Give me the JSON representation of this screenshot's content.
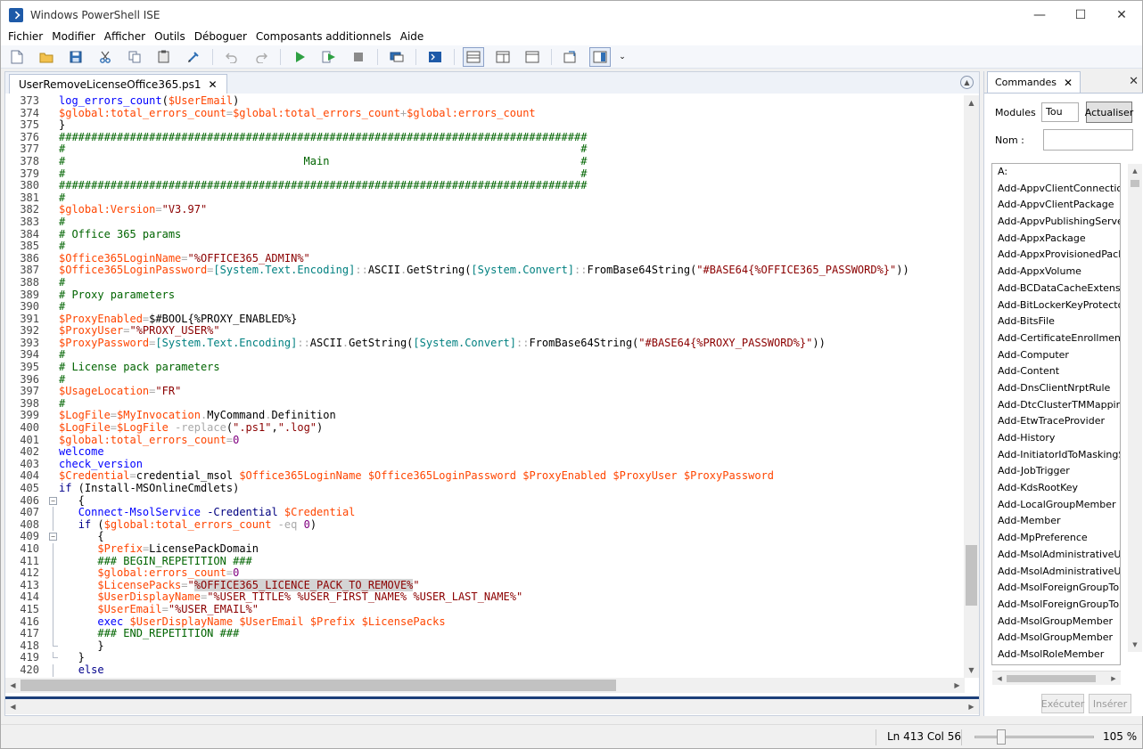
{
  "window": {
    "title": "Windows PowerShell ISE",
    "minimize": "—",
    "maximize": "☐",
    "close": "✕"
  },
  "menu": [
    "Fichier",
    "Modifier",
    "Afficher",
    "Outils",
    "Déboguer",
    "Composants additionnels",
    "Aide"
  ],
  "editor": {
    "tab_label": "UserRemoveLicenseOffice365.ps1",
    "tab_close": "✕",
    "line_numbers": [
      373,
      374,
      375,
      376,
      377,
      378,
      379,
      380,
      381,
      382,
      383,
      384,
      385,
      386,
      387,
      388,
      389,
      390,
      391,
      392,
      393,
      394,
      395,
      396,
      397,
      398,
      399,
      400,
      401,
      402,
      403,
      404,
      405,
      406,
      407,
      408,
      409,
      410,
      411,
      412,
      413,
      414,
      415,
      416,
      417,
      418,
      419,
      420
    ],
    "lines": [
      "log_errors_count($UserEmail)",
      "$global:total_errors_count=$global:total_errors_count+$global:errors_count",
      "}",
      "##################################################################################",
      "#                                                                                #",
      "#                                     Main                                       #",
      "#                                                                                #",
      "##################################################################################",
      "#",
      "$global:Version=\"V3.97\"",
      "#",
      "# Office 365 params",
      "#",
      "$Office365LoginName=\"%OFFICE365_ADMIN%\"",
      "$Office365LoginPassword=[System.Text.Encoding]::ASCII.GetString([System.Convert]::FromBase64String(\"#BASE64{%OFFICE365_PASSWORD%}\"))",
      "#",
      "# Proxy parameters",
      "#",
      "$ProxyEnabled=$#BOOL{%PROXY_ENABLED%}",
      "$ProxyUser=\"%PROXY_USER%\"",
      "$ProxyPassword=[System.Text.Encoding]::ASCII.GetString([System.Convert]::FromBase64String(\"#BASE64{%PROXY_PASSWORD%}\"))",
      "#",
      "# License pack parameters",
      "#",
      "$UsageLocation=\"FR\"",
      "#",
      "$LogFile=$MyInvocation.MyCommand.Definition",
      "$LogFile=$LogFile -replace(\".ps1\",\".log\")",
      "$global:total_errors_count=0",
      "welcome",
      "check_version",
      "$Credential=credential_msol $Office365LoginName $Office365LoginPassword $ProxyEnabled $ProxyUser $ProxyPassword",
      "if (Install-MSOnlineCmdlets)",
      "   {",
      "   Connect-MsolService -Credential $Credential",
      "   if ($global:total_errors_count -eq 0)",
      "      {",
      "      $Prefix=LicensePackDomain",
      "      ### BEGIN_REPETITION ###",
      "      $global:errors_count=0",
      "      $LicensePacks=\"%OFFICE365_LICENCE_PACK_TO_REMOVE%\"",
      "      $UserDisplayName=\"%USER_TITLE% %USER_FIRST_NAME% %USER_LAST_NAME%\"",
      "      $UserEmail=\"%USER_EMAIL%\"",
      "      exec $UserDisplayName $UserEmail $Prefix $LicensePacks",
      "      ### END_REPETITION ###",
      "      }",
      "   }",
      "   else"
    ]
  },
  "commands": {
    "tab_label": "Commandes",
    "tab_close": "✕",
    "panel_close": "✕",
    "modules_label": "Modules",
    "modules_value": "Tou",
    "refresh_label": "Actualiser",
    "name_label": "Nom :",
    "name_value": "",
    "items": [
      "A:",
      "Add-AppvClientConnection",
      "Add-AppvClientPackage",
      "Add-AppvPublishingServer",
      "Add-AppxPackage",
      "Add-AppxProvisionedPackage",
      "Add-AppxVolume",
      "Add-BCDataCacheExtension",
      "Add-BitLockerKeyProtector",
      "Add-BitsFile",
      "Add-CertificateEnrollmentPolicyServer",
      "Add-Computer",
      "Add-Content",
      "Add-DnsClientNrptRule",
      "Add-DtcClusterTMMapping",
      "Add-EtwTraceProvider",
      "Add-History",
      "Add-InitiatorIdToMaskingSet",
      "Add-JobTrigger",
      "Add-KdsRootKey",
      "Add-LocalGroupMember",
      "Add-Member",
      "Add-MpPreference",
      "Add-MsolAdministrativeUnitMember",
      "Add-MsolAdministrativeUnitMember",
      "Add-MsolForeignGroupToRole",
      "Add-MsolForeignGroupToRole",
      "Add-MsolGroupMember",
      "Add-MsolGroupMember",
      "Add-MsolRoleMember"
    ],
    "run_label": "Exécuter",
    "insert_label": "Insérer"
  },
  "status": {
    "position": "Ln 413  Col 56",
    "zoom": "105 %"
  }
}
